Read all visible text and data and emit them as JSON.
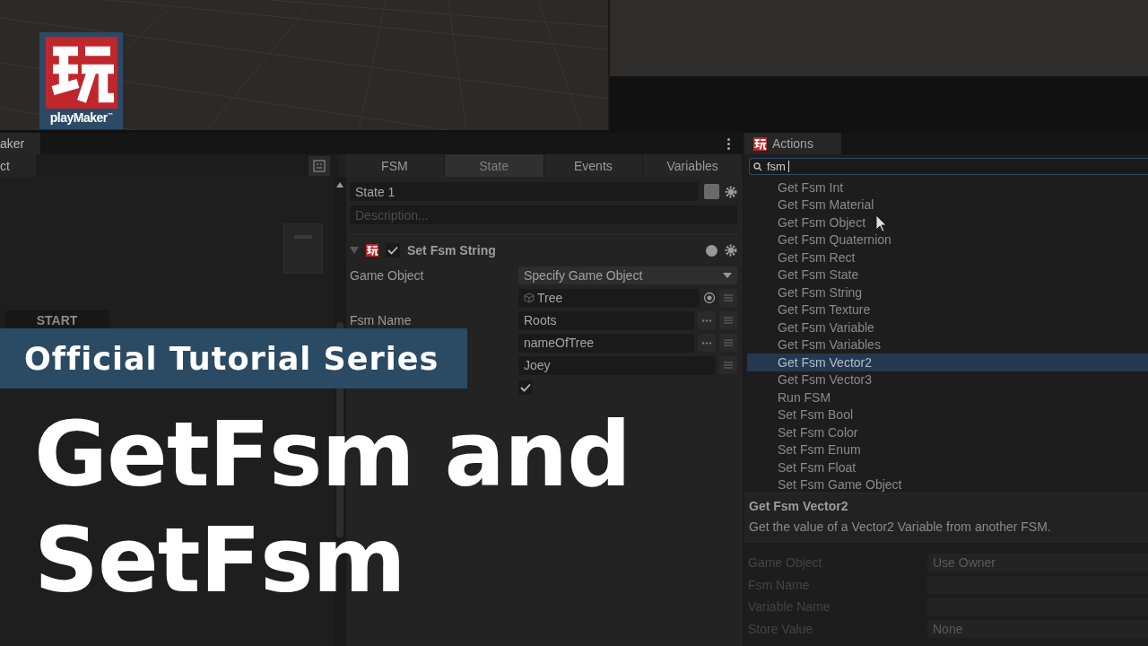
{
  "logo": {
    "label": "playMaker",
    "trademark": "™"
  },
  "overlay": {
    "series": "Official Tutorial Series",
    "title_lines": [
      "GetFsm and",
      "SetFsm"
    ]
  },
  "fsm_window": {
    "tab_title": "aker",
    "toolbar_label": "ct",
    "tabs": [
      {
        "label": "FSM",
        "selected": false
      },
      {
        "label": "State",
        "selected": true
      },
      {
        "label": "Events",
        "selected": false
      },
      {
        "label": "Variables",
        "selected": false
      }
    ],
    "graph": {
      "start_node": "START"
    },
    "state": {
      "name": "State 1",
      "placeholder": "Description..."
    },
    "action": {
      "title": "Set Fsm String",
      "enabled": true,
      "expanded": true,
      "fields": [
        {
          "kind": "dropdown",
          "label": "Game Object",
          "value": "Specify Game Object"
        },
        {
          "kind": "object",
          "value": "Tree"
        },
        {
          "kind": "text",
          "label": "Fsm Name",
          "value": "Roots",
          "browse": true
        },
        {
          "kind": "text",
          "value": "nameOfTree",
          "browse": true
        },
        {
          "kind": "text",
          "value": "Joey",
          "browse": false
        },
        {
          "kind": "checkbox",
          "checked": true
        }
      ]
    }
  },
  "actions_window": {
    "title": "Actions",
    "search": {
      "value": "fsm"
    },
    "items": [
      {
        "label": "Get Fsm Int",
        "selected": false
      },
      {
        "label": "Get Fsm Material",
        "selected": false
      },
      {
        "label": "Get Fsm Object",
        "selected": false
      },
      {
        "label": "Get Fsm Quaternion",
        "selected": false
      },
      {
        "label": "Get Fsm Rect",
        "selected": false
      },
      {
        "label": "Get Fsm State",
        "selected": false
      },
      {
        "label": "Get Fsm String",
        "selected": false
      },
      {
        "label": "Get Fsm Texture",
        "selected": false
      },
      {
        "label": "Get Fsm Variable",
        "selected": false
      },
      {
        "label": "Get Fsm Variables",
        "selected": false
      },
      {
        "label": "Get Fsm Vector2",
        "selected": true
      },
      {
        "label": "Get Fsm Vector3",
        "selected": false
      },
      {
        "label": "Run FSM",
        "selected": false
      },
      {
        "label": "Set Fsm Bool",
        "selected": false
      },
      {
        "label": "Set Fsm Color",
        "selected": false
      },
      {
        "label": "Set Fsm Enum",
        "selected": false
      },
      {
        "label": "Set Fsm Float",
        "selected": false
      },
      {
        "label": "Set Fsm Game Object",
        "selected": false
      }
    ],
    "detail": {
      "title": "Get Fsm Vector2",
      "description": "Get the value of a Vector2 Variable from another FSM."
    },
    "params": [
      {
        "label": "Game Object",
        "value": "Use Owner"
      },
      {
        "label": "Fsm Name"
      },
      {
        "label": "Variable Name"
      },
      {
        "label": "Store Value",
        "value": "None"
      }
    ]
  }
}
